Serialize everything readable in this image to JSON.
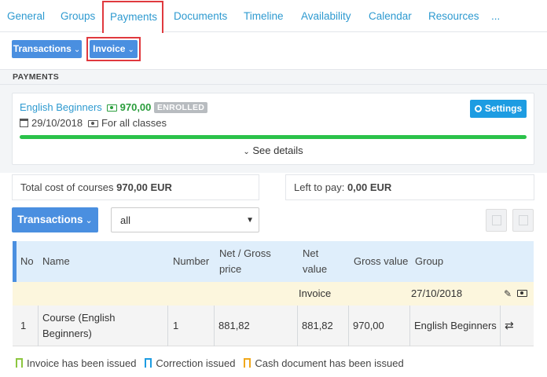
{
  "tabs": [
    {
      "label": "General"
    },
    {
      "label": "Groups"
    },
    {
      "label": "Payments"
    },
    {
      "label": "Documents"
    },
    {
      "label": "Timeline"
    },
    {
      "label": "Availability"
    },
    {
      "label": "Calendar"
    },
    {
      "label": "Resources"
    },
    {
      "label": "..."
    }
  ],
  "toolbar": {
    "transactions_label": "Transactions",
    "invoice_label": "Invoice"
  },
  "section": {
    "title": "PAYMENTS"
  },
  "enrollment": {
    "course": "English Beginners",
    "amount": "970,00",
    "status": "ENROLLED",
    "date": "29/10/2018",
    "scope": "For all classes",
    "settings_label": "Settings",
    "progress_percent": 100,
    "see_details_label": "See details"
  },
  "summary": {
    "total_label": "Total cost of courses",
    "total_value": "970,00 EUR",
    "left_label": "Left to pay:",
    "left_value": "0,00 EUR"
  },
  "filters": {
    "transactions_label": "Transactions",
    "selected": "all"
  },
  "table": {
    "headers": {
      "no": "No",
      "name": "Name",
      "number": "Number",
      "net_price_1": "Net / Gross",
      "net_price_2": "price",
      "net_value_1": "Net",
      "net_value_2": "value",
      "gross_value": "Gross value",
      "group": "Group"
    },
    "invoice_row": {
      "type": "Invoice",
      "date": "27/10/2018"
    },
    "rows": [
      {
        "no": "1",
        "name_1": "Course (English",
        "name_2": "Beginners)",
        "number": "1",
        "net_price": "881,82",
        "net_value": "881,82",
        "gross_value": "970,00",
        "group": "English Beginners"
      }
    ]
  },
  "legend": [
    {
      "label": "Invoice has been issued",
      "color": "#8cc63f"
    },
    {
      "label": "Correction issued",
      "color": "#1d9ce2"
    },
    {
      "label": "Cash document has been issued",
      "color": "#f0a81b"
    }
  ]
}
